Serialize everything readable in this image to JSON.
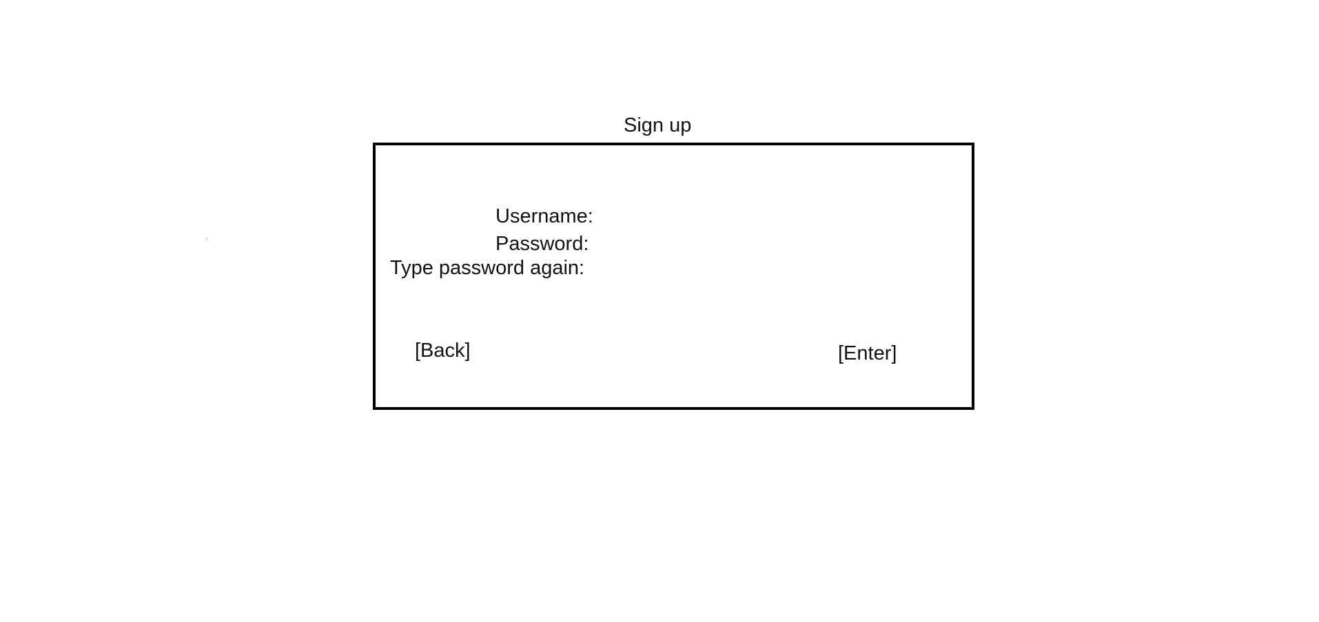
{
  "page": {
    "title": "Sign up"
  },
  "form": {
    "username_label": "Username:",
    "password_label": "Password:",
    "password_again_label": "Type password again:"
  },
  "actions": {
    "back_label": "[Back]",
    "enter_label": "[Enter]"
  },
  "colors": {
    "background": "#ffffff",
    "border": "#000000",
    "text": "#111111"
  }
}
